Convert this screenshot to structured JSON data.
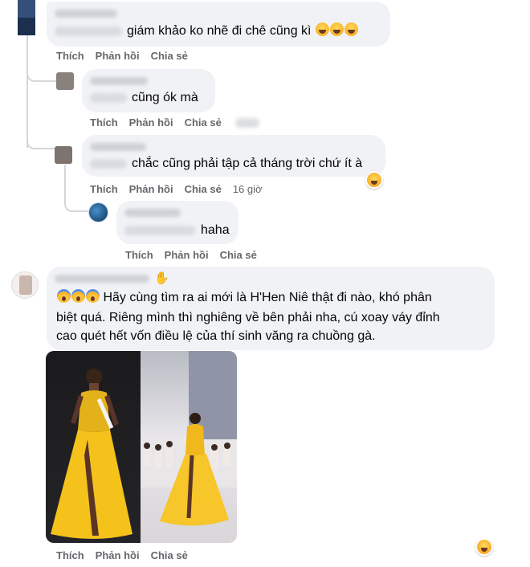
{
  "comments": [
    {
      "text": "giám khảo ko nhẽ đi chê cũng kì",
      "emojis": [
        "laughing-tears-emoji",
        "laughing-tears-emoji",
        "laughing-tears-emoji"
      ],
      "actions": {
        "like": "Thích",
        "reply": "Phản hồi",
        "share": "Chia sẻ"
      }
    },
    {
      "text": "cũng ók mà",
      "actions": {
        "like": "Thích",
        "reply": "Phản hồi",
        "share": "Chia sẻ"
      }
    },
    {
      "text": "chắc cũng phải tập cả tháng trời chứ ít à",
      "actions": {
        "like": "Thích",
        "reply": "Phản hồi",
        "share": "Chia sẻ",
        "time": "16 giờ"
      }
    },
    {
      "text": "haha",
      "actions": {
        "like": "Thích",
        "reply": "Phản hồi",
        "share": "Chia sẻ"
      }
    },
    {
      "lines": [
        "Hãy cùng tìm ra ai mới là H'Hen Niê thật đi nào, khó phân",
        "biệt quá. Riêng mình thì nghiêng về bên phải nha, cú xoay váy đỉnh",
        "cao quét hết vốn điều lệ của thí sinh văng ra chuồng gà."
      ],
      "emojis": [
        "screaming-emoji",
        "screaming-emoji",
        "screaming-emoji"
      ],
      "actions": {
        "like": "Thích",
        "reply": "Phản hồi",
        "share": "Chia sẻ"
      }
    }
  ],
  "icons": {
    "reaction": "haha-reaction-icon",
    "wave": "waving-hand-icon"
  },
  "colors": {
    "bubble": "#f0f2f5",
    "action_text": "#65676b",
    "dress_yellow": "#f4c21a"
  }
}
